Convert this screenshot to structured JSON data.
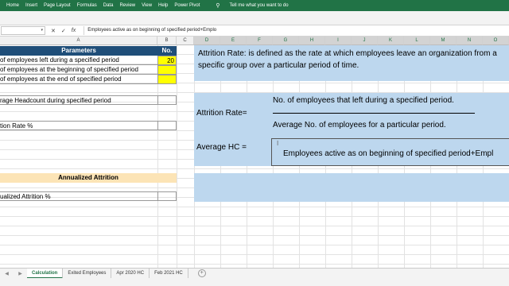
{
  "ribbon": {
    "tabs": [
      "Home",
      "Insert",
      "Page Layout",
      "Formulas",
      "Data",
      "Review",
      "View",
      "Help",
      "Power Pivot"
    ],
    "tell_me": "Tell me what you want to do"
  },
  "formula_bar": {
    "cancel": "✕",
    "enter": "✓",
    "fx": "fx",
    "content": "Employees active as on beginning of specified period+Emplo"
  },
  "columns": [
    "A",
    "B",
    "C",
    "D",
    "E",
    "F",
    "G",
    "H",
    "I",
    "J",
    "K",
    "L",
    "M",
    "N",
    "O"
  ],
  "cells": {
    "a_params_header": "Parameters",
    "b_no_header": "No.",
    "a_left": "of employees left during a specified period",
    "b_left_value": "20",
    "a_begin": "of employees at the beginning of specified period",
    "a_end": "of employees at the end of specified period",
    "a_headcount": "rage Headcount during specified period",
    "a_attrition_rate": "tion Rate %",
    "a_annualized_header": "Annualized Attrition",
    "a_annualized_pct": "ualized Attrition %"
  },
  "notes": {
    "definition": "Attrition Rate: is defined as the rate at which employees leave an organization from a specific group over a particular period of time.",
    "attrition_label": "Attrition Rate=",
    "numerator": "No. of employees that left during a specified period.",
    "denominator": "Average No. of employees for a particular period.",
    "avg_hc_label": "Average HC =",
    "avg_hc_text": "Employees active as on beginning of specified period+Empl"
  },
  "sheets": [
    "Calculation",
    "Exited Employees",
    "Apr 2020 HC",
    "Feb 2021 HC"
  ],
  "active_sheet": "Calculation",
  "icons": {
    "tell_me": "lightbulb-icon",
    "add_sheet": "plus-circle-icon",
    "cursor": "text-cursor-icon"
  },
  "colors": {
    "excel_green": "#217346",
    "header_blue": "#1f4e79",
    "input_yellow": "#ffff00",
    "note_blue": "#bdd7ee",
    "orange_band": "#fce4b6"
  }
}
